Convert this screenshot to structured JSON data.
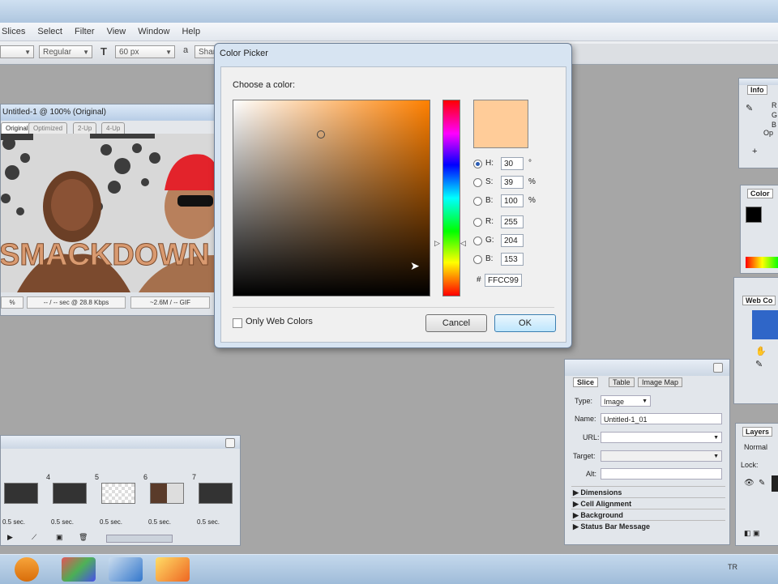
{
  "menu": [
    "Slices",
    "Select",
    "Filter",
    "View",
    "Window",
    "Help"
  ],
  "options_bar": {
    "font_style": "Regular",
    "font_size": "60 px",
    "anti_alias": "Shar"
  },
  "document": {
    "title": "Untitled-1 @ 100% (Original)",
    "tabs": [
      "Original",
      "Optimized",
      "2-Up",
      "4-Up"
    ],
    "banner_text": "SMACKDOWN",
    "status_zoom": "%",
    "status_time": "-- / -- sec @ 28.8 Kbps",
    "status_format": "~2.6M / -- GIF"
  },
  "frames_panel": {
    "frames": [
      {
        "num": "",
        "delay": "0.5 sec."
      },
      {
        "num": "4",
        "delay": "0.5 sec."
      },
      {
        "num": "5",
        "delay": "0.5 sec."
      },
      {
        "num": "6",
        "delay": "0.5 sec."
      },
      {
        "num": "7",
        "delay": "0.5 sec."
      }
    ]
  },
  "color_picker": {
    "title": "Color Picker",
    "choose_label": "Choose a color:",
    "fields": [
      {
        "label": "H:",
        "value": "30",
        "unit": "°",
        "checked": true
      },
      {
        "label": "S:",
        "value": "39",
        "unit": "%",
        "checked": false
      },
      {
        "label": "B:",
        "value": "100",
        "unit": "%",
        "checked": false
      },
      {
        "label": "R:",
        "value": "255",
        "unit": "",
        "checked": false
      },
      {
        "label": "G:",
        "value": "204",
        "unit": "",
        "checked": false
      },
      {
        "label": "B:",
        "value": "153",
        "unit": "",
        "checked": false
      }
    ],
    "hex_label": "#",
    "hex_value": "FFCC99",
    "only_web_colors": "Only Web Colors",
    "cancel": "Cancel",
    "ok": "OK",
    "selected_color": "#ffcc99",
    "hue_degrees": 30,
    "saturation_pct": 39,
    "brightness_pct": 100
  },
  "info_panel": {
    "tab": "Info",
    "labels": [
      "R",
      "G",
      "B",
      "Op"
    ]
  },
  "color_panel": {
    "tab": "Color"
  },
  "web_panel": {
    "tab": "Web Co"
  },
  "slice_panel": {
    "tabs": [
      "Slice",
      "Table",
      "Image Map"
    ],
    "type_label": "Type:",
    "type_value": "Image",
    "name_label": "Name:",
    "name_value": "Untitled-1_01",
    "url_label": "URL:",
    "target_label": "Target:",
    "alt_label": "Alt:",
    "sections": [
      "Dimensions",
      "Cell Alignment",
      "Background",
      "Status Bar Message"
    ]
  },
  "layers_panel": {
    "tab": "Layers",
    "blend": "Normal",
    "lock_label": "Lock:"
  },
  "taskbar": {
    "tray_text": "TR"
  }
}
